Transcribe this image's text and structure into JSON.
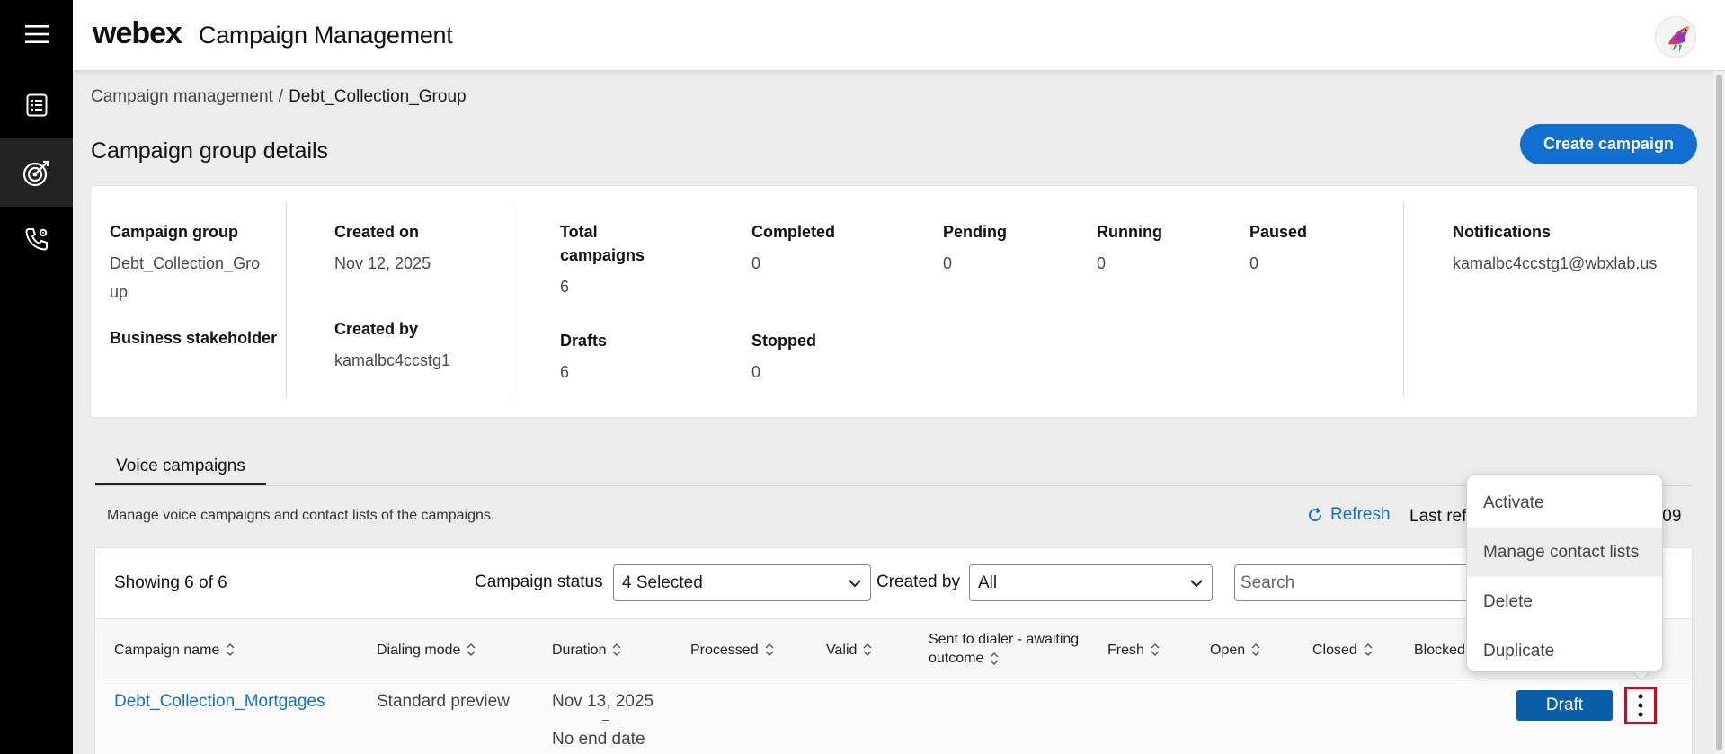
{
  "header": {
    "brand": "webex",
    "app_title": "Campaign Management"
  },
  "breadcrumb": {
    "parent": "Campaign management",
    "separator": "/",
    "current": "Debt_Collection_Group"
  },
  "page": {
    "title": "Campaign group details",
    "create_button": "Create campaign"
  },
  "details": {
    "campaign_group_label": "Campaign group",
    "campaign_group_value_1": "Debt_Collection_Gro",
    "campaign_group_value_2": "up",
    "business_stakeholder_label": "Business stakeholder",
    "created_on_label": "Created on",
    "created_on_value": "Nov 12, 2025",
    "created_by_label": "Created by",
    "created_by_value": "kamalbc4ccstg1",
    "total_label_1": "Total",
    "total_label_2": "campaigns",
    "total_value": "6",
    "completed_label": "Completed",
    "completed_value": "0",
    "pending_label": "Pending",
    "pending_value": "0",
    "running_label": "Running",
    "running_value": "0",
    "paused_label": "Paused",
    "paused_value": "0",
    "drafts_label": "Drafts",
    "drafts_value": "6",
    "stopped_label": "Stopped",
    "stopped_value": "0",
    "notifications_label": "Notifications",
    "notifications_value": "kamalbc4ccstg1@wbxlab.us"
  },
  "tabs": {
    "voice": "Voice campaigns"
  },
  "voice": {
    "description": "Manage voice campaigns and contact lists of the campaigns.",
    "refresh": "Refresh",
    "last_refreshed_visible": "Last ref",
    "last_refreshed_time_visible": ":09"
  },
  "table": {
    "showing": "Showing 6 of 6",
    "status_label": "Campaign status",
    "status_value": "4 Selected",
    "created_by_label": "Created by",
    "created_by_value": "All",
    "search_placeholder": "Search",
    "columns": {
      "name": "Campaign name",
      "dialing": "Dialing mode",
      "duration": "Duration",
      "processed": "Processed",
      "valid": "Valid",
      "sent_1": "Sent to dialer - awaiting",
      "sent_2": "outcome",
      "fresh": "Fresh",
      "open": "Open",
      "closed": "Closed",
      "blocked": "Blocked"
    },
    "rows": [
      {
        "name": "Debt_Collection_Mortgages",
        "dialing_mode": "Standard preview",
        "start": "Nov 13, 2025",
        "dash": "–",
        "end": "No end date",
        "status": "Draft"
      }
    ]
  },
  "menu": {
    "items": [
      "Activate",
      "Manage contact lists",
      "Delete",
      "Duplicate"
    ]
  },
  "colors": {
    "accent": "#1170cf",
    "draft_badge": "#0a5fa8",
    "highlight_border": "#e0001a",
    "rail": "#000000"
  }
}
